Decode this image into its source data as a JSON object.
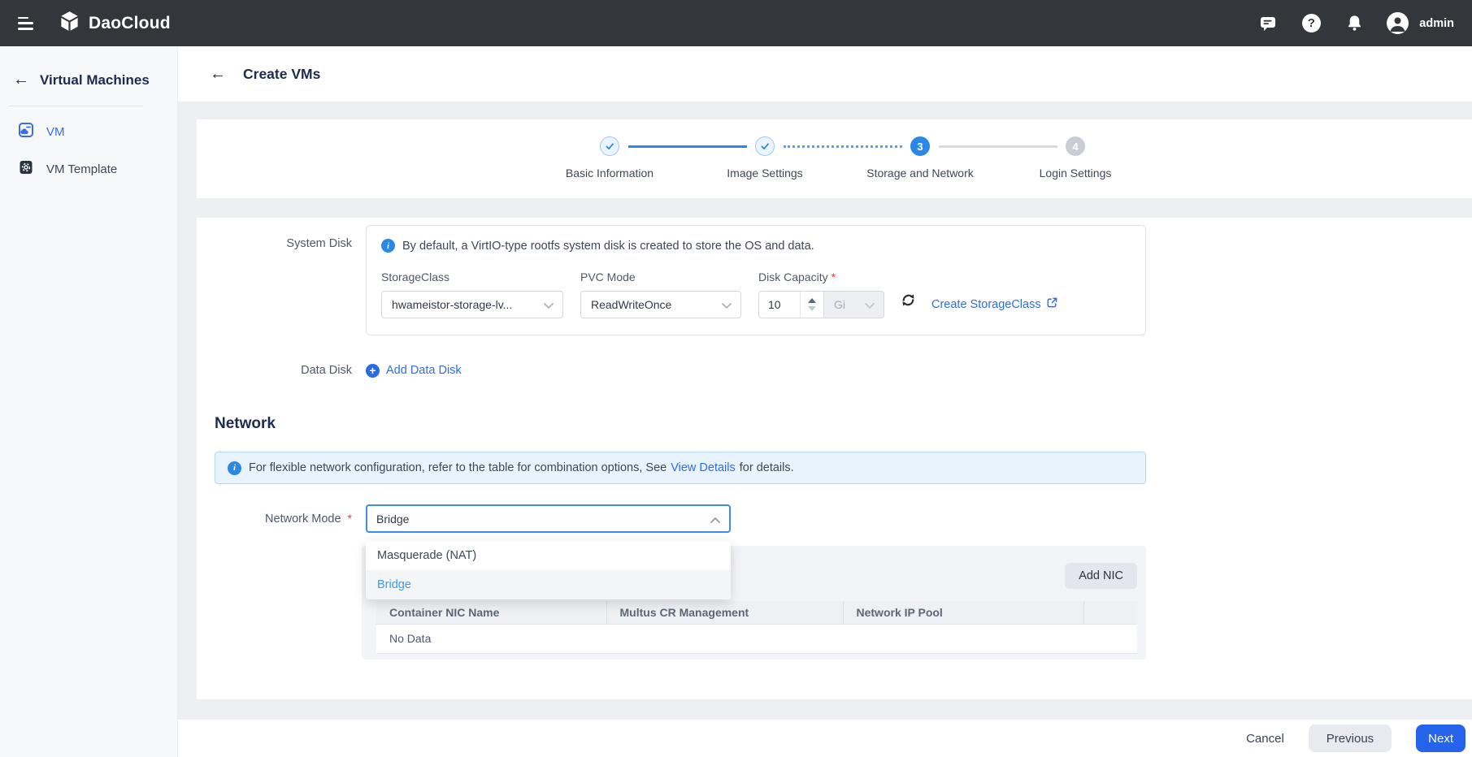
{
  "topbar": {
    "brand": "DaoCloud",
    "user": "admin"
  },
  "sidebar": {
    "title": "Virtual Machines",
    "items": [
      {
        "label": "VM",
        "active": true
      },
      {
        "label": "VM Template",
        "active": false
      }
    ]
  },
  "header": {
    "title": "Create VMs"
  },
  "stepper": {
    "steps": [
      {
        "label": "Basic Information",
        "state": "done"
      },
      {
        "label": "Image Settings",
        "state": "done"
      },
      {
        "label": "Storage and Network",
        "state": "active",
        "number": "3"
      },
      {
        "label": "Login Settings",
        "state": "pending",
        "number": "4"
      }
    ]
  },
  "system_disk": {
    "label": "System Disk",
    "info": "By default, a VirtIO-type rootfs system disk is created to store the OS and data.",
    "storage_class": {
      "label": "StorageClass",
      "value": "hwameistor-storage-lv..."
    },
    "pvc_mode": {
      "label": "PVC Mode",
      "value": "ReadWriteOnce"
    },
    "disk_capacity": {
      "label": "Disk Capacity",
      "value": "10",
      "unit": "Gi"
    },
    "create_link": "Create StorageClass"
  },
  "data_disk": {
    "label": "Data Disk",
    "add_link": "Add Data Disk"
  },
  "network": {
    "heading": "Network",
    "alert": {
      "prefix": "For flexible network configuration, refer to the table for combination options, See",
      "link": "View Details",
      "suffix": "for details."
    },
    "mode": {
      "label": "Network Mode",
      "value": "Bridge",
      "options": [
        {
          "label": "Masquerade (NAT)",
          "selected": false
        },
        {
          "label": "Bridge",
          "selected": true
        }
      ]
    },
    "nic": {
      "add_button": "Add NIC",
      "columns": [
        "Container NIC Name",
        "Multus CR Management",
        "Network IP Pool"
      ],
      "empty_text": "No Data"
    }
  },
  "footer": {
    "cancel": "Cancel",
    "previous": "Previous",
    "next": "Next"
  },
  "icons": {
    "back_arrow": "←",
    "question_mark": "?",
    "info": "i",
    "asterisk": "*",
    "plus": "+"
  },
  "colors": {
    "topbar": "#33363b",
    "accent_blue": "#2563eb",
    "link_blue": "#2e6ee6",
    "stepper_blue": "#2b87e8",
    "alert_bg": "#e9f3fd",
    "alert_border": "#b5d9f8",
    "sidebar_bg": "#f7f8fa",
    "page_bg": "#edeff3"
  }
}
